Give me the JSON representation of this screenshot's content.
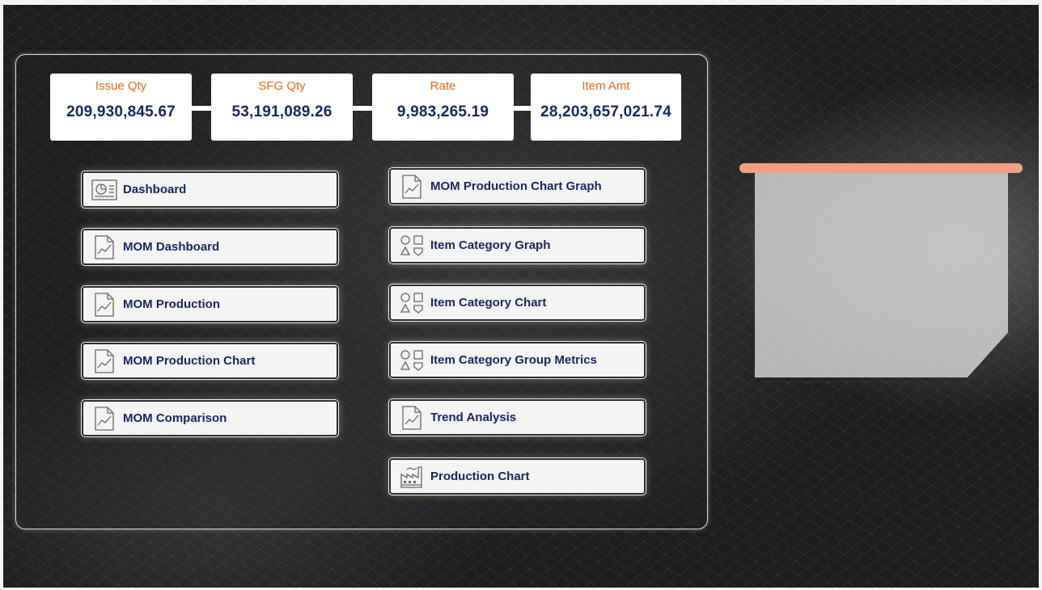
{
  "kpis": [
    {
      "label": "Issue Qty",
      "value": "209,930,845.67"
    },
    {
      "label": "SFG Qty",
      "value": "53,191,089.26"
    },
    {
      "label": "Rate",
      "value": "9,983,265.19"
    },
    {
      "label": "Item Amt",
      "value": "28,203,657,021.74"
    }
  ],
  "nav_left": [
    {
      "label": "Dashboard",
      "icon": "dashboard-icon"
    },
    {
      "label": "MOM Dashboard",
      "icon": "report-icon"
    },
    {
      "label": "MOM Production",
      "icon": "report-icon"
    },
    {
      "label": "MOM Production Chart",
      "icon": "report-icon"
    },
    {
      "label": "MOM Comparison",
      "icon": "report-icon"
    }
  ],
  "nav_right": [
    {
      "label": "MOM Production Chart Graph",
      "icon": "report-icon"
    },
    {
      "label": "Item Category Graph",
      "icon": "shapes-icon"
    },
    {
      "label": "Item Category Chart",
      "icon": "shapes-icon"
    },
    {
      "label": "Item Category Group Metrics",
      "icon": "shapes-icon"
    },
    {
      "label": "Trend Analysis",
      "icon": "report-icon"
    },
    {
      "label": "Production Chart",
      "icon": "factory-icon"
    }
  ],
  "colors": {
    "kpi_label": "#e56a1a",
    "value_text": "#17265e",
    "accent_bar": "#f0a080"
  }
}
